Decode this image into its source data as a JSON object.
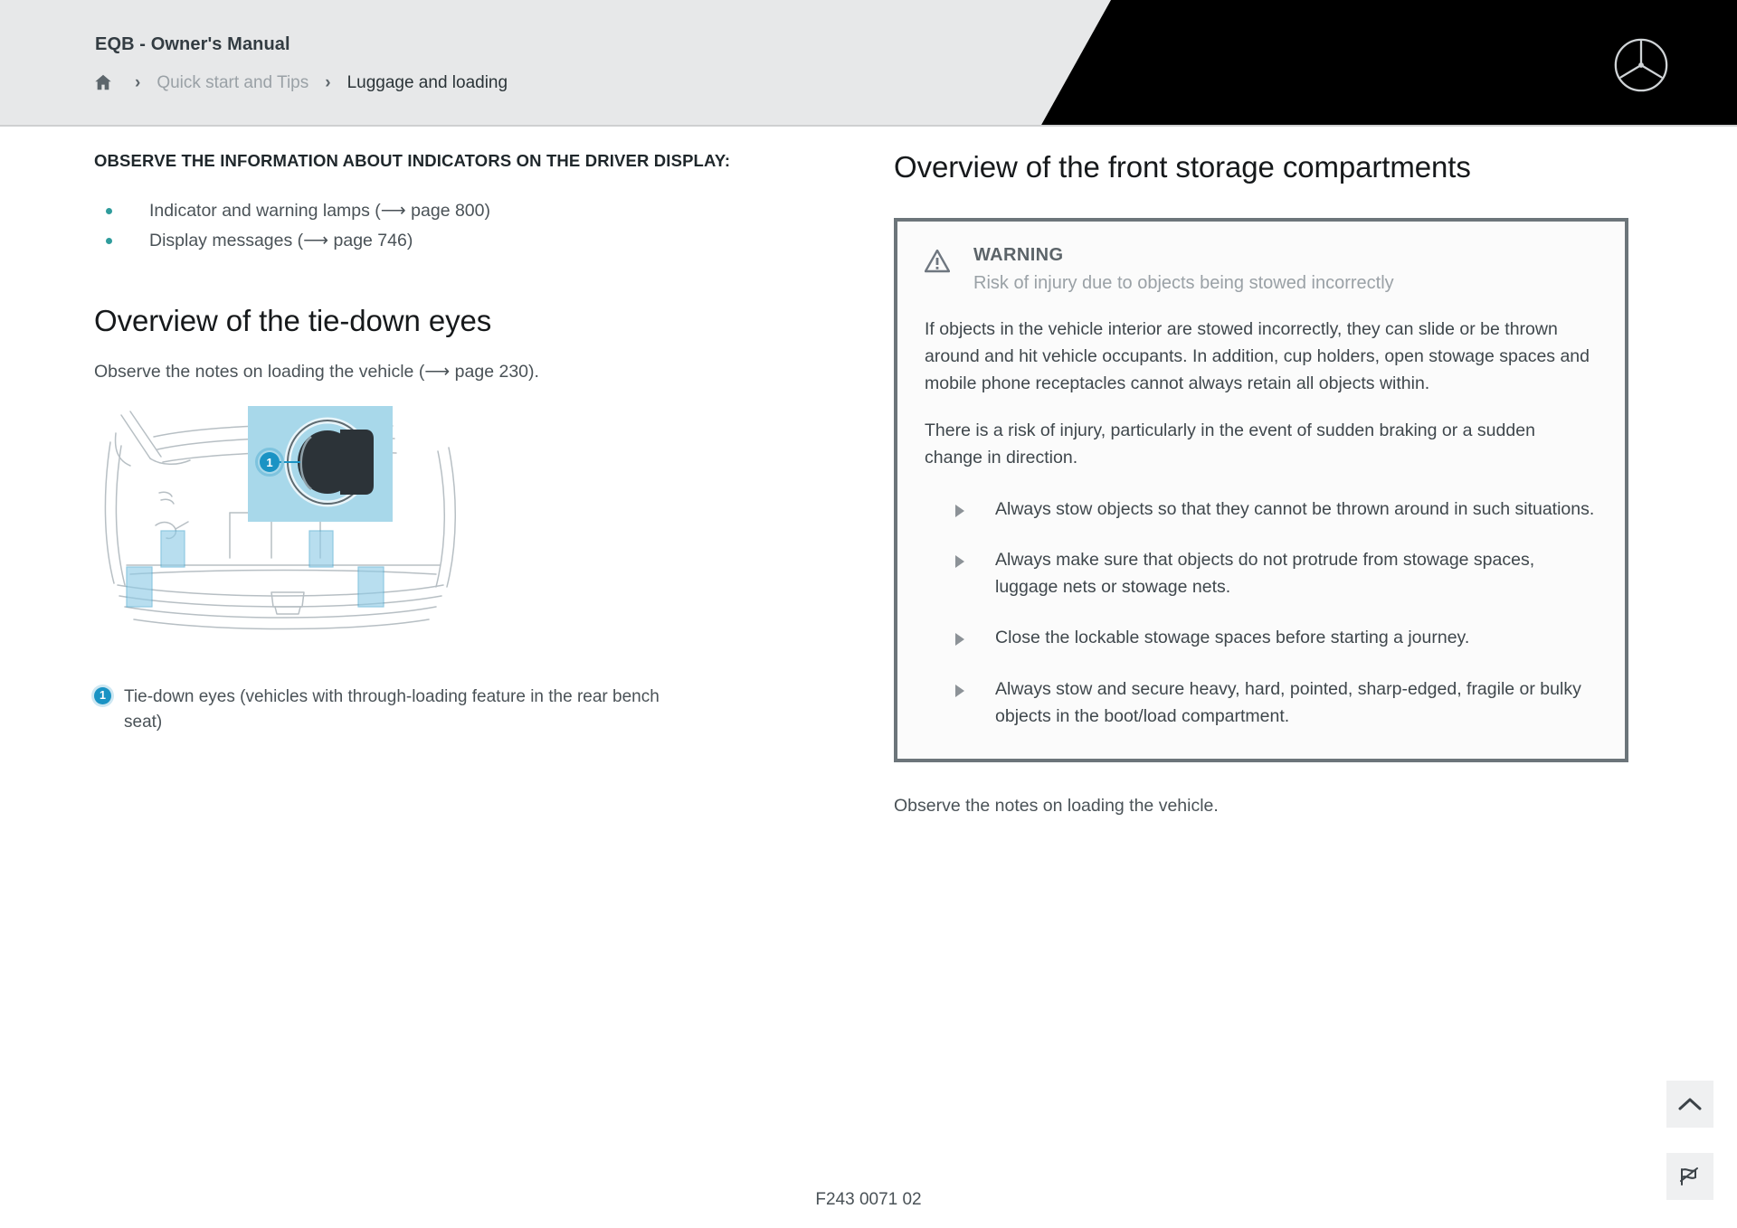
{
  "header": {
    "doc_title": "EQB - Owner's Manual",
    "home_icon": "home-icon",
    "separator": "›",
    "breadcrumb": [
      {
        "label": "Quick start and Tips",
        "active": false
      },
      {
        "label": "Luggage and loading",
        "active": true
      }
    ],
    "logo": "mercedes-benz-star-logo",
    "accent_black": "#000000",
    "bar_color": "#e7e8e9"
  },
  "left_column": {
    "kicker": "OBSERVE THE INFORMATION ABOUT INDICATORS ON THE DRIVER DISPLAY:",
    "bullets": [
      "Indicator and warning lamps (⟶ page 800)",
      "Display messages (⟶ page 746)"
    ],
    "bullet_color": "#2f9c9c",
    "section_heading": "Overview of the tie-down eyes",
    "lead": "Observe the notes on loading the vehicle (⟶ page 230).",
    "figure": {
      "name": "vehicle-rear-tie-down-eyes-illustration",
      "callout_number": "1",
      "inset_fill": "#a8d8ea",
      "highlight_fill": "#9ed3ea"
    },
    "caption": {
      "number": "1",
      "text": "Tie-down eyes (vehicles with through-loading feature in the rear bench seat)"
    }
  },
  "right_column": {
    "section_heading": "Overview of the front storage compartments",
    "warning": {
      "icon": "warning-triangle-icon",
      "title": "WARNING",
      "subtitle": "Risk of injury due to objects being stowed incorrectly",
      "paragraphs": [
        "If objects in the vehicle interior are stowed incorrectly, they can slide or be thrown around and hit vehicle occupants. In addition, cup holders, open stowage spaces and mobile phone receptacles cannot always retain all objects within.",
        "There is a risk of injury, particularly in the event of sudden braking or a sudden change in direction."
      ],
      "actions": [
        "Always stow objects so that they cannot be thrown around in such situations.",
        "Always make sure that objects do not protrude from stowage spaces, luggage nets or stowage nets.",
        "Close the lockable stowage spaces before starting a journey.",
        "Always stow and secure heavy, hard, pointed, sharp-edged, fragile or bulky objects in the boot/load compartment."
      ],
      "border_color": "#6c757a"
    },
    "after_box_text": "Observe the notes on loading the vehicle."
  },
  "side_controls": [
    {
      "name": "scroll-to-top-button",
      "icon": "chevron-up-icon"
    },
    {
      "name": "report-issue-button",
      "icon": "broken-flag-icon"
    }
  ],
  "footer": {
    "figure_id": "F243 0071 02"
  }
}
